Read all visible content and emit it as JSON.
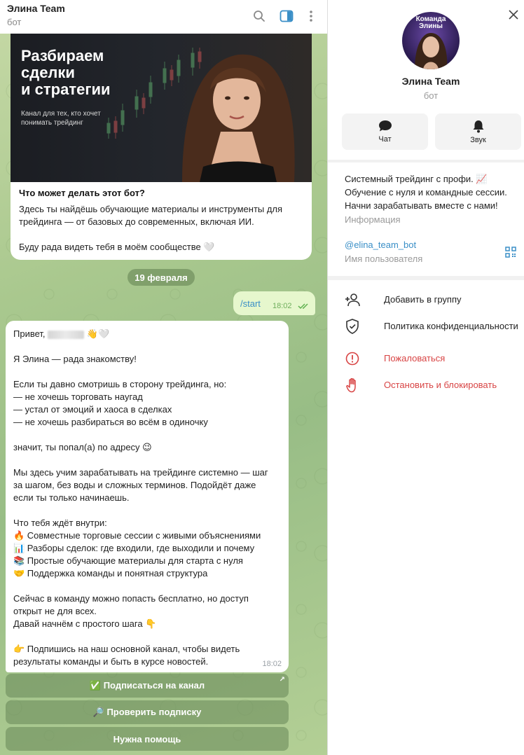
{
  "chat_header": {
    "title": "Элина Team",
    "subtitle": "бот",
    "icons": [
      "search-icon",
      "sidebar-toggle-icon",
      "more-vertical-icon"
    ]
  },
  "intro_card": {
    "hero_title": "Разбираем\nсделки\nи стратегии",
    "hero_subtitle": "Канал для тех, кто хочет\nпонимать трейдинг",
    "heading": "Что может делать этот бот?",
    "paragraph1": "Здесь ты найдёшь обучающие материалы и инструменты для трейдинга — от базовых до современных, включая ИИ.",
    "paragraph2": "Буду рада видеть тебя в моём сообществе 🤍"
  },
  "date_pill": "19 февраля",
  "outgoing": {
    "text": "/start",
    "time": "18:02"
  },
  "incoming": {
    "greeting_prefix": "Привет, ",
    "greeting_suffix": " 👋🤍",
    "lines": [
      "",
      "Я Элина — рада знакомству!",
      "",
      "Если ты давно смотришь в сторону трейдинга, но:",
      "— не хочешь торговать наугад",
      "— устал от эмоций и хаоса в сделках",
      "— не хочешь разбираться во всём в одиночку",
      "",
      "значит, ты попал(а) по адресу 😉",
      "",
      "Мы здесь учим зарабатывать на трейдинге системно — шаг",
      "за шагом, без воды и сложных терминов. Подойдёт даже",
      "если ты только начинаешь.",
      "",
      "Что тебя ждёт внутри:",
      "🔥 Совместные торговые сессии с живыми объяснениями",
      "📊 Разборы сделок: где входили, где выходили и почему",
      "📚 Простые обучающие материалы для старта с нуля",
      "🤝 Поддержка команды и понятная структура",
      "",
      "Сейчас в команду можно попасть бесплатно, но доступ",
      "открыт не для всех.",
      "Давай начнём с простого шага 👇",
      "",
      "👉 Подпишись на наш основной канал, чтобы видеть",
      "результаты команды и быть в курсе новостей."
    ],
    "time": "18:02"
  },
  "keyboard": {
    "subscribe": "✅ Подписаться на канал",
    "check": "🔎 Проверить подписку",
    "help": "Нужна помощь"
  },
  "profile": {
    "avatar_text": "Команда\nЭлины",
    "name": "Элина Team",
    "subtitle": "бот",
    "actions": {
      "chat": "Чат",
      "sound": "Звук"
    },
    "description": "Системный трейдинг с профи. 📈\nОбучение с нуля и командные сессии.\nНачни зарабатывать вместе с нами!",
    "description_label": "Информация",
    "username": "@elina_team_bot",
    "username_label": "Имя пользователя",
    "menu": {
      "add_to_group": "Добавить в группу",
      "privacy": "Политика конфиденциальности",
      "report": "Пожаловаться",
      "block": "Остановить и блокировать"
    }
  },
  "colors": {
    "accent": "#3a8fc7",
    "danger": "#d84444",
    "outgoing_bubble": "#e6f7cd",
    "keyboard_button": "#6c8c5c"
  }
}
